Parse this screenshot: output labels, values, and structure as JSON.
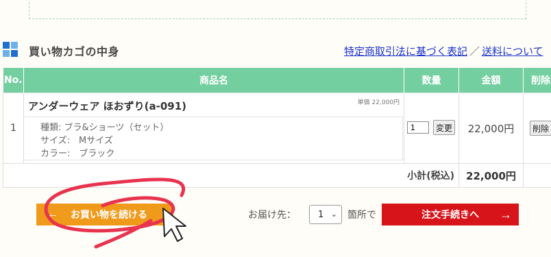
{
  "section": {
    "title": "買い物カゴの中身",
    "icon": "grid-icon",
    "links": [
      {
        "label": "特定商取引法に基づく表記"
      },
      {
        "label": "送料について"
      }
    ],
    "separator": "／"
  },
  "table": {
    "headers": {
      "no": "No.",
      "name": "商品名",
      "qty": "数量",
      "price": "金額",
      "delete": "削除"
    },
    "header_color": "#74cfa0",
    "row": {
      "no": "1",
      "name": "アンダーウェア ほおずり(a-091)",
      "unit_price": "単価 22,000円",
      "options": [
        "種類: ブラ&ショーツ（セット）",
        "サイズ:　Mサイズ",
        "カラー:　ブラック"
      ],
      "qty": "1",
      "change_label": "変更",
      "price": "22,000円",
      "delete_label": "削除"
    },
    "subtotal_label": "小計(税込)",
    "subtotal_value": "22,000円"
  },
  "actions": {
    "continue_label": "お買い物を続ける",
    "continue_color": "#f09a1b",
    "dest_label": "お届け先：",
    "dest_value": "1",
    "place_label": "箇所で",
    "order_label": "注文手続きへ",
    "order_color": "#d8141b"
  }
}
